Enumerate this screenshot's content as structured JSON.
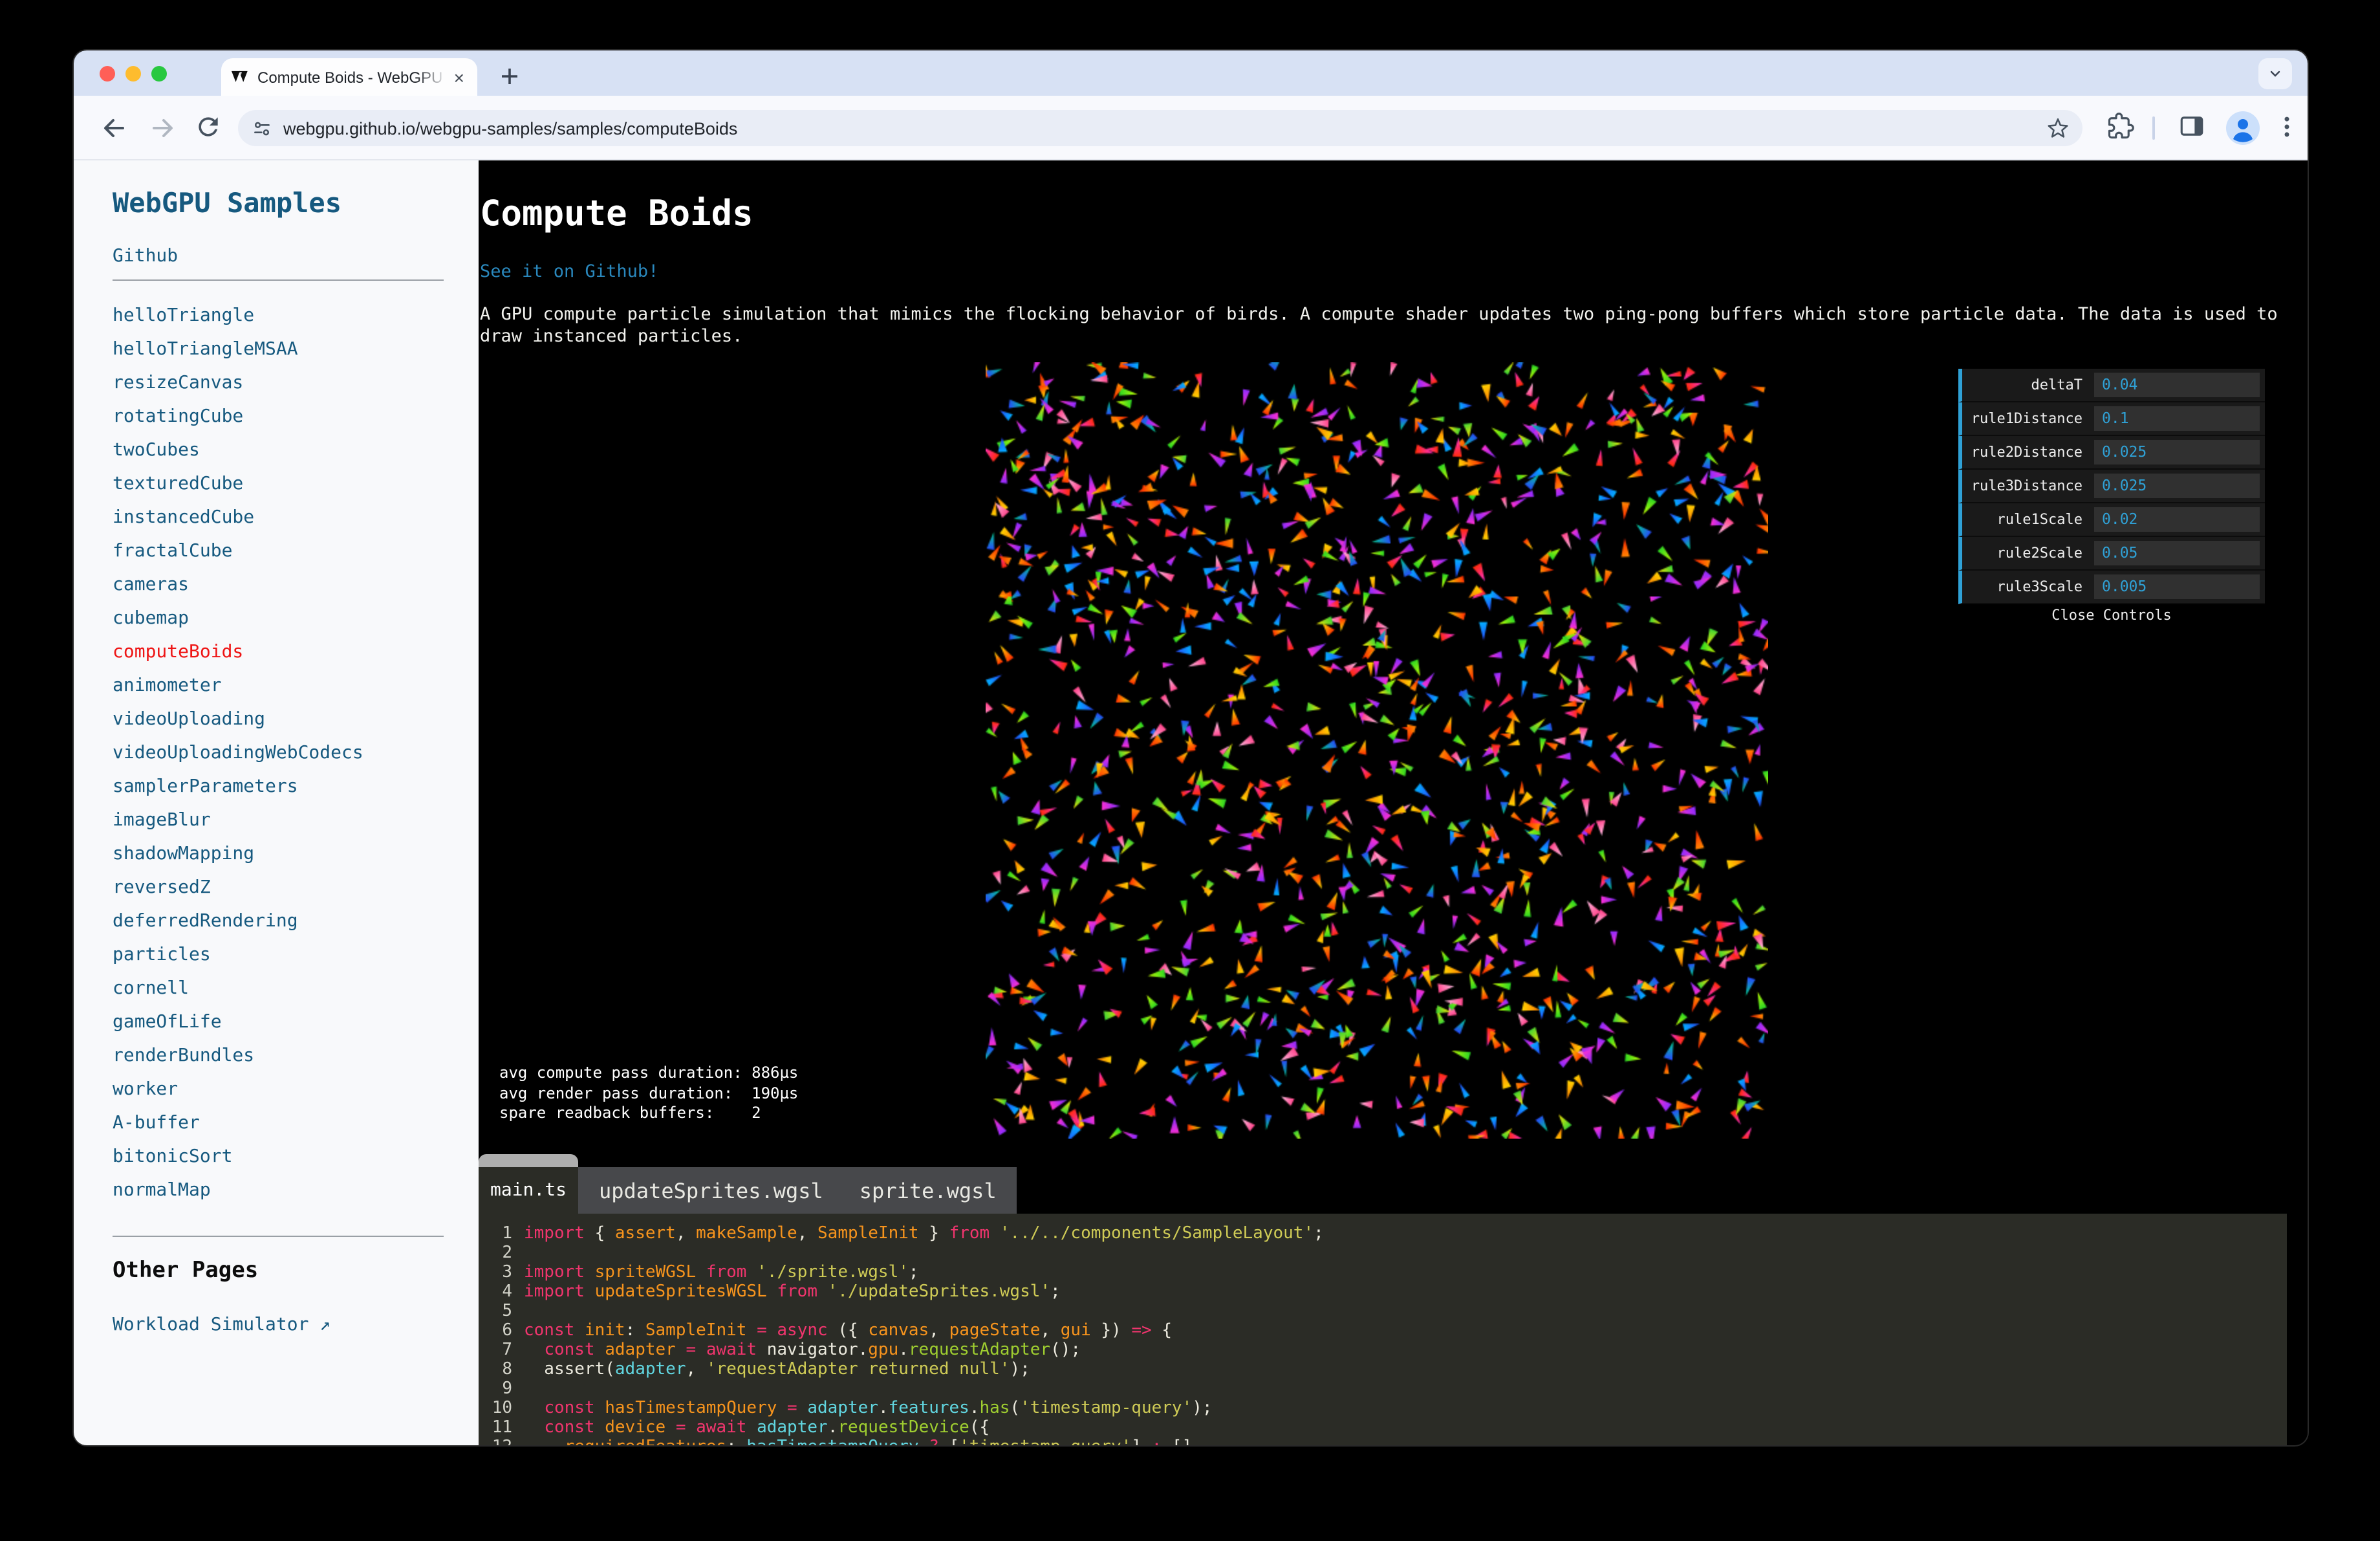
{
  "browser": {
    "tab_title": "Compute Boids - WebGPU S",
    "tab_close": "×",
    "new_tab": "+",
    "url": "webgpu.github.io/webgpu-samples/samples/computeBoids"
  },
  "sidebar": {
    "title": "WebGPU Samples",
    "github_label": "Github",
    "samples": [
      "helloTriangle",
      "helloTriangleMSAA",
      "resizeCanvas",
      "rotatingCube",
      "twoCubes",
      "texturedCube",
      "instancedCube",
      "fractalCube",
      "cameras",
      "cubemap",
      "computeBoids",
      "animometer",
      "videoUploading",
      "videoUploadingWebCodecs",
      "samplerParameters",
      "imageBlur",
      "shadowMapping",
      "reversedZ",
      "deferredRendering",
      "particles",
      "cornell",
      "gameOfLife",
      "renderBundles",
      "worker",
      "A-buffer",
      "bitonicSort",
      "normalMap"
    ],
    "active_sample": "computeBoids",
    "other_pages_heading": "Other Pages",
    "workload_label": "Workload Simulator ↗"
  },
  "main": {
    "title": "Compute Boids",
    "github_link": "See it on Github!",
    "description": "A GPU compute particle simulation that mimics the flocking behavior of birds. A compute shader updates two ping-pong buffers which store particle data. The data is used to draw instanced particles.",
    "stats_text": "avg compute pass duration: 886µs\navg render pass duration:  190µs\nspare readback buffers:    2"
  },
  "gui": {
    "accent": "#2FA1D6",
    "controls": [
      {
        "label": "deltaT",
        "value": "0.04"
      },
      {
        "label": "rule1Distance",
        "value": "0.1"
      },
      {
        "label": "rule2Distance",
        "value": "0.025"
      },
      {
        "label": "rule3Distance",
        "value": "0.025"
      },
      {
        "label": "rule1Scale",
        "value": "0.02"
      },
      {
        "label": "rule2Scale",
        "value": "0.05"
      },
      {
        "label": "rule3Scale",
        "value": "0.005"
      }
    ],
    "close_label": "Close Controls"
  },
  "code": {
    "tabs": [
      "main.ts",
      "updateSprites.wgsl",
      "sprite.wgsl"
    ],
    "active_tab": "main.ts",
    "lines": [
      {
        "n": 1,
        "tokens": [
          [
            "k",
            "import"
          ],
          [
            "w",
            " { "
          ],
          [
            "o",
            "assert"
          ],
          [
            "w",
            ", "
          ],
          [
            "o",
            "makeSample"
          ],
          [
            "w",
            ", "
          ],
          [
            "o",
            "SampleInit"
          ],
          [
            "w",
            " } "
          ],
          [
            "k",
            "from"
          ],
          [
            "w",
            " "
          ],
          [
            "s",
            "'../../components/SampleLayout'"
          ],
          [
            "w",
            ";"
          ]
        ]
      },
      {
        "n": 2,
        "tokens": []
      },
      {
        "n": 3,
        "tokens": [
          [
            "k",
            "import"
          ],
          [
            "w",
            " "
          ],
          [
            "o",
            "spriteWGSL"
          ],
          [
            "w",
            " "
          ],
          [
            "k",
            "from"
          ],
          [
            "w",
            " "
          ],
          [
            "s",
            "'./sprite.wgsl'"
          ],
          [
            "w",
            ";"
          ]
        ]
      },
      {
        "n": 4,
        "tokens": [
          [
            "k",
            "import"
          ],
          [
            "w",
            " "
          ],
          [
            "o",
            "updateSpritesWGSL"
          ],
          [
            "w",
            " "
          ],
          [
            "k",
            "from"
          ],
          [
            "w",
            " "
          ],
          [
            "s",
            "'./updateSprites.wgsl'"
          ],
          [
            "w",
            ";"
          ]
        ]
      },
      {
        "n": 5,
        "tokens": []
      },
      {
        "n": 6,
        "tokens": [
          [
            "k",
            "const"
          ],
          [
            "w",
            " "
          ],
          [
            "o",
            "init"
          ],
          [
            "w",
            ": "
          ],
          [
            "o",
            "SampleInit"
          ],
          [
            "w",
            " "
          ],
          [
            "k",
            "="
          ],
          [
            "w",
            " "
          ],
          [
            "k",
            "async"
          ],
          [
            "w",
            " ({ "
          ],
          [
            "o",
            "canvas"
          ],
          [
            "w",
            ", "
          ],
          [
            "o",
            "pageState"
          ],
          [
            "w",
            ", "
          ],
          [
            "o",
            "gui"
          ],
          [
            "w",
            " }) "
          ],
          [
            "k",
            "=>"
          ],
          [
            "w",
            " {"
          ]
        ]
      },
      {
        "n": 7,
        "tokens": [
          [
            "w",
            "  "
          ],
          [
            "k",
            "const"
          ],
          [
            "w",
            " "
          ],
          [
            "o",
            "adapter"
          ],
          [
            "w",
            " "
          ],
          [
            "k",
            "="
          ],
          [
            "w",
            " "
          ],
          [
            "k",
            "await"
          ],
          [
            "w",
            " navigator."
          ],
          [
            "o",
            "gpu"
          ],
          [
            "w",
            "."
          ],
          [
            "g",
            "requestAdapter"
          ],
          [
            "w",
            "();"
          ]
        ]
      },
      {
        "n": 8,
        "tokens": [
          [
            "w",
            "  assert("
          ],
          [
            "c",
            "adapter"
          ],
          [
            "w",
            ", "
          ],
          [
            "s",
            "'requestAdapter returned null'"
          ],
          [
            "w",
            ");"
          ]
        ]
      },
      {
        "n": 9,
        "tokens": []
      },
      {
        "n": 10,
        "tokens": [
          [
            "w",
            "  "
          ],
          [
            "k",
            "const"
          ],
          [
            "w",
            " "
          ],
          [
            "o",
            "hasTimestampQuery"
          ],
          [
            "w",
            " "
          ],
          [
            "k",
            "="
          ],
          [
            "w",
            " "
          ],
          [
            "c",
            "adapter"
          ],
          [
            "w",
            "."
          ],
          [
            "c",
            "features"
          ],
          [
            "w",
            "."
          ],
          [
            "g",
            "has"
          ],
          [
            "w",
            "("
          ],
          [
            "s",
            "'timestamp-query'"
          ],
          [
            "w",
            ");"
          ]
        ]
      },
      {
        "n": 11,
        "tokens": [
          [
            "w",
            "  "
          ],
          [
            "k",
            "const"
          ],
          [
            "w",
            " "
          ],
          [
            "o",
            "device"
          ],
          [
            "w",
            " "
          ],
          [
            "k",
            "="
          ],
          [
            "w",
            " "
          ],
          [
            "k",
            "await"
          ],
          [
            "w",
            " "
          ],
          [
            "c",
            "adapter"
          ],
          [
            "w",
            "."
          ],
          [
            "g",
            "requestDevice"
          ],
          [
            "w",
            "({"
          ]
        ]
      },
      {
        "n": 12,
        "tokens": [
          [
            "w",
            "    "
          ],
          [
            "o",
            "requiredFeatures"
          ],
          [
            "w",
            ": "
          ],
          [
            "c",
            "hasTimestampQuery"
          ],
          [
            "w",
            " "
          ],
          [
            "k",
            "?"
          ],
          [
            "w",
            " ["
          ],
          [
            "s",
            "'timestamp-query'"
          ],
          [
            "w",
            "] "
          ],
          [
            "k",
            ":"
          ],
          [
            "w",
            " [],"
          ]
        ]
      }
    ]
  },
  "boids": {
    "count": 1300,
    "seed": 20240,
    "background": "#000000",
    "palette_pairs": [
      [
        "#ff2a00",
        "#ffe600"
      ],
      [
        "#ff8a00",
        "#ff2200"
      ],
      [
        "#ff2fd0",
        "#7a2bff"
      ],
      [
        "#ff3f87",
        "#ffc3e6"
      ],
      [
        "#24d424",
        "#c8ff00"
      ],
      [
        "#2747ff",
        "#00d48a"
      ],
      [
        "#8a2bff",
        "#ff2fd0"
      ],
      [
        "#ffd400",
        "#ff7a00"
      ],
      [
        "#00b3ff",
        "#2747ff"
      ],
      [
        "#ff2a00",
        "#ff2fd0"
      ],
      [
        "#35d435",
        "#ffe600"
      ]
    ]
  }
}
